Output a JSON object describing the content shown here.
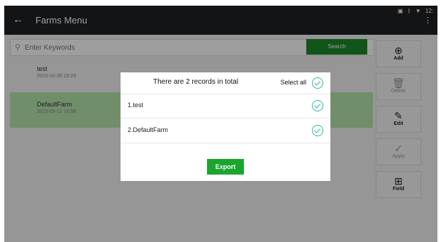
{
  "titlebar": {
    "title": "Farms Menu",
    "back_icon": "arrow-left-icon",
    "status_time": "12:",
    "status_icons": [
      "battery-icon",
      "bluetooth-icon",
      "wifi-icon"
    ],
    "menu_icon": "more-vertical-icon"
  },
  "search": {
    "placeholder": "Enter Keywords",
    "value": "",
    "button_label": "Search",
    "icon": "search-icon"
  },
  "farms": [
    {
      "name": "test",
      "date": "2023-10-30 10:28",
      "selected": false
    },
    {
      "name": "DefaultFarm",
      "date": "2023-09-12 10:58",
      "selected": true
    }
  ],
  "sidebar": {
    "buttons": [
      {
        "label": "Add",
        "icon": "add-icon",
        "glyph": "⊕",
        "enabled": true
      },
      {
        "label": "Delete",
        "icon": "delete-icon",
        "glyph": "🗑",
        "enabled": false
      },
      {
        "label": "Edit",
        "icon": "edit-icon",
        "glyph": "✎",
        "enabled": true
      },
      {
        "label": "Apply",
        "icon": "check-icon",
        "glyph": "✓",
        "enabled": false
      },
      {
        "label": "Field",
        "icon": "grid-icon",
        "glyph": "⊞",
        "enabled": true
      }
    ]
  },
  "dialog": {
    "title": "There are 2 records in total",
    "select_all_label": "Select all",
    "records": [
      {
        "label": "1.test",
        "checked": true
      },
      {
        "label": "2.DefaultFarm",
        "checked": true
      }
    ],
    "export_label": "Export"
  },
  "colors": {
    "accent_green": "#1aa52e",
    "check_teal": "#2eb8a0",
    "selected_row": "#b6e6ad",
    "titlebar": "#202124"
  }
}
